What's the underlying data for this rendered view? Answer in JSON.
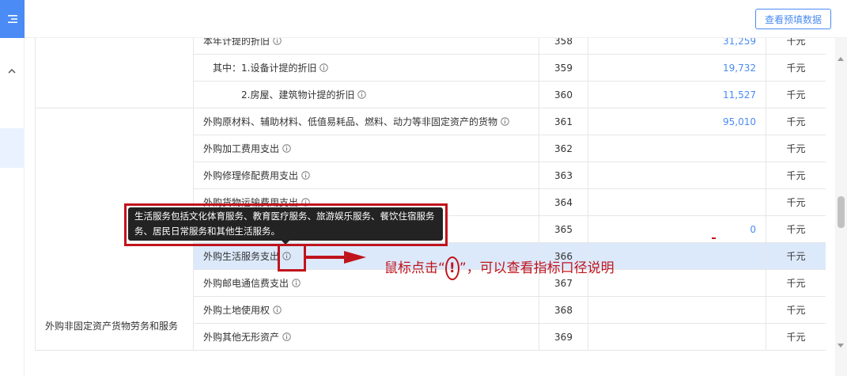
{
  "header": {
    "preview_button": "查看预填数据"
  },
  "table": {
    "category": "外购非固定资产货物劳务和服务",
    "rows": [
      {
        "name": "本年计提的折旧",
        "code": "358",
        "value": "31,259",
        "unit": "千元"
      },
      {
        "name": "其中：1.设备计提的折旧",
        "code": "359",
        "value": "19,732",
        "unit": "千元"
      },
      {
        "name": "2.房屋、建筑物计提的折旧",
        "code": "360",
        "value": "11,527",
        "unit": "千元"
      },
      {
        "name": "外购原材料、辅助材料、低值易耗品、燃料、动力等非固定资产的货物",
        "code": "361",
        "value": "95,010",
        "unit": "千元"
      },
      {
        "name": "外购加工费用支出",
        "code": "362",
        "value": "",
        "unit": "千元"
      },
      {
        "name": "外购修理修配费用支出",
        "code": "363",
        "value": "",
        "unit": "千元"
      },
      {
        "name": "外购货物运输费用支出",
        "code": "364",
        "value": "",
        "unit": "千元"
      },
      {
        "name": "",
        "code": "365",
        "value": "0",
        "unit": "千元"
      },
      {
        "name": "外购生活服务支出",
        "code": "366",
        "value": "",
        "unit": "千元"
      },
      {
        "name": "外购邮电通信费支出",
        "code": "367",
        "value": "",
        "unit": "千元"
      },
      {
        "name": "外购土地使用权",
        "code": "368",
        "value": "",
        "unit": "千元"
      },
      {
        "name": "外购其他无形资产",
        "code": "369",
        "value": "",
        "unit": "千元"
      }
    ]
  },
  "tooltip": {
    "line1": "生活服务包括文化体育服务、教育医疗服务、旅游娱乐服务、餐饮住宿服务",
    "line2": "务、居民日常服务和其他生活服务。"
  },
  "annotation": {
    "before": "鼠标点击“",
    "mark": "!",
    "after": "”，可以查看指标口径说明"
  },
  "colors": {
    "accent": "#4a8bf5",
    "annotation": "#c0141c",
    "highlight_row": "#dce9fb"
  }
}
